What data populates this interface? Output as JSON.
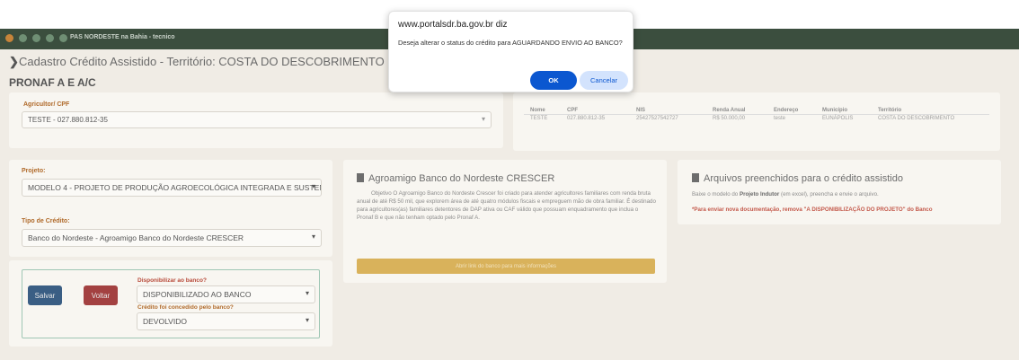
{
  "header": {
    "window_title": "PAS NORDESTE na Bahia - tecnico"
  },
  "page": {
    "heading": "Cadastro Crédito Assistido - Território: COSTA DO DESCOBRIMENTO",
    "subheading": "PRONAF A E A/C"
  },
  "agricultor": {
    "label": "Agricultor/ CPF",
    "value": "TESTE - 027.880.812-35"
  },
  "info_table": {
    "headers": [
      "Nome",
      "CPF",
      "NIS",
      "Renda Anual",
      "Endereço",
      "Município",
      "Território"
    ],
    "values": [
      "TESTE",
      "027.880.812-35",
      "25427527542727",
      "R$ 50.000,00",
      "teste",
      "EUNÁPOLIS",
      "COSTA DO DESCOBRIMENTO"
    ]
  },
  "form": {
    "projeto_label": "Projeto:",
    "projeto_value": "MODELO 4 - PROJETO DE PRODUÇÃO AGROECOLÓGICA INTEGRADA E SUSTENT",
    "tipo_label": "Tipo de Crédito:",
    "tipo_value": "Banco do Nordeste - Agroamigo Banco do Nordeste CRESCER"
  },
  "actions": {
    "save_label": "Salvar",
    "back_label": "Voltar",
    "disponibilizar_label": "Disponibilizar ao banco?",
    "disponibilizar_value": "DISPONIBILIZADO AO BANCO",
    "concedido_label": "Crédito foi concedido pelo banco?",
    "concedido_value": "DEVOLVIDO"
  },
  "agroamigo": {
    "title": "Agroamigo Banco do Nordeste CRESCER",
    "text": "Objetivo O Agroamigo Banco do Nordeste Crescer foi criado para atender agricultores familiares com renda bruta anual de até R$ 50 mil, que explorem área de até quatro módulos fiscais e empreguem mão de obra familiar. É destinado para agricultores(as) familiares detentores de DAP ativa ou CAF válido que possuam enquadramento que inclua o Pronaf B e que não tenham optado pelo Pronaf A.",
    "link_label": "Abrir link do banco para mais informações"
  },
  "arquivos": {
    "title": "Arquivos preenchidos para o crédito assistido",
    "text_before": "Baixe o modelo do ",
    "text_bold": "Projeto Indutor",
    "text_after": " (em excel), preencha e envie o arquivo.",
    "warning": "*Para enviar nova documentação, remova \"A DISPONIBILIZAÇÃO DO PROJETO\" do Banco"
  },
  "dialog": {
    "title": "www.portalsdr.ba.gov.br diz",
    "message": "Deseja alterar o status do crédito para AGUARDANDO ENVIO AO BANCO?",
    "ok_label": "OK",
    "cancel_label": "Cancelar"
  }
}
